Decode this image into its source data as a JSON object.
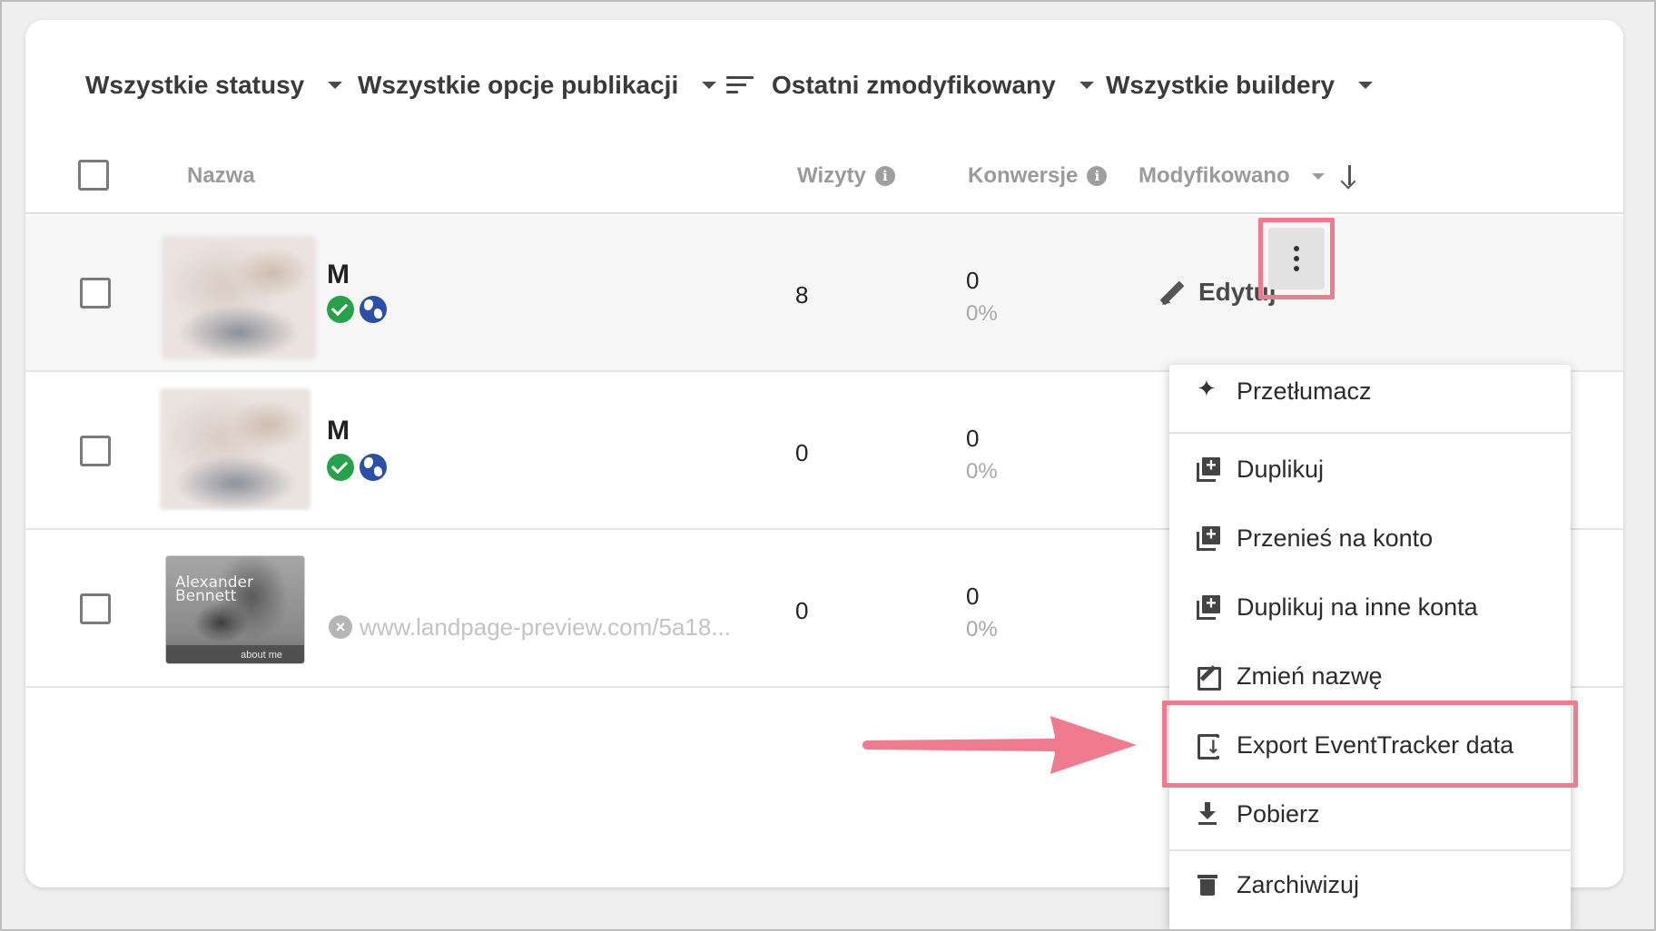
{
  "filters": {
    "status": "Wszystkie statusy",
    "publish": "Wszystkie opcje publikacji",
    "sort": "Ostatni zmodyfikowany",
    "builders": "Wszystkie buildery"
  },
  "columns": {
    "name": "Nazwa",
    "visits": "Wizyty",
    "conversions": "Konwersje",
    "modified": "Modyfikowano"
  },
  "rows": [
    {
      "title": "M",
      "visits": "8",
      "conversions": "0",
      "conversion_rate": "0%",
      "status": "published"
    },
    {
      "title": "M",
      "visits": "0",
      "conversions": "0",
      "conversion_rate": "0%",
      "status": "published"
    },
    {
      "title": "",
      "url": "www.landpage-preview.com/5a18...",
      "thumb_name": "Alexander Bennett",
      "thumb_footer": "about me",
      "visits": "0",
      "conversions": "0",
      "conversion_rate": "0%",
      "status": "unpublished"
    }
  ],
  "row_actions": {
    "edit": "Edytuj"
  },
  "menu": {
    "items": [
      {
        "label": "Przetłumacz",
        "icon": "sparkle-icon"
      },
      {
        "label": "Duplikuj",
        "icon": "duplicate-icon"
      },
      {
        "label": "Przenieś na konto",
        "icon": "duplicate-icon"
      },
      {
        "label": "Duplikuj na inne konta",
        "icon": "duplicate-icon"
      },
      {
        "label": "Zmień nazwę",
        "icon": "rename-icon"
      },
      {
        "label": "Export EventTracker data",
        "icon": "export-icon"
      },
      {
        "label": "Pobierz",
        "icon": "download-icon"
      },
      {
        "label": "Zarchiwizuj",
        "icon": "trash-icon"
      }
    ]
  },
  "colors": {
    "highlight": "#f07a8e",
    "success": "#27a24a",
    "globe": "#2b4fa8"
  }
}
